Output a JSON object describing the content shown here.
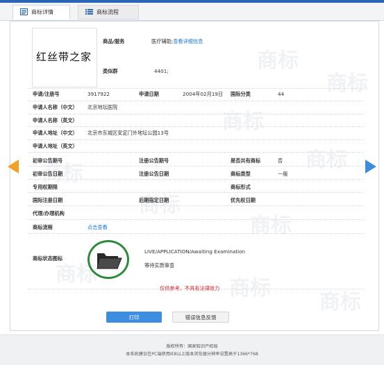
{
  "tabs": {
    "detail": "商标详情",
    "process": "商标流程"
  },
  "logo": {
    "text": "红丝带之家"
  },
  "header": {
    "goods_label": "商品/服务",
    "goods_value": "医疗辅助;",
    "goods_link": "查看详细信息",
    "class_label": "类似群",
    "class_value": "4401;"
  },
  "fields": {
    "reg_no_label": "申请/注册号",
    "reg_no_value": "3917922",
    "apply_date_label": "申请日期",
    "apply_date_value": "2004年02月19日",
    "intl_class_label": "国际分类",
    "intl_class_value": "44",
    "applicant_cn_label": "申请人名称（中文）",
    "applicant_cn_value": "北京地坛医院",
    "applicant_en_label": "申请人名称（英文）",
    "address_cn_label": "申请人地址（中文）",
    "address_cn_value": "北京市东城区安定门外地坛公园13号",
    "address_en_label": "申请人地址（英文）",
    "prelim_no_label": "初审公告期号",
    "reg_pub_no_label": "注册公告期号",
    "shared_label": "是否共有商标",
    "shared_value": "否",
    "prelim_date_label": "初审公告日期",
    "reg_pub_date_label": "注册公告日期",
    "tm_type_label": "商标类型",
    "tm_type_value": "一般",
    "exclusive_label": "专用权期限",
    "tm_form_label": "商标形式",
    "intl_reg_date_label": "国际注册日期",
    "later_date_label": "后期指定日期",
    "priority_date_label": "优先权日期",
    "agent_label": "代理/办理机构",
    "process_label": "商标流程",
    "process_link": "点击查看",
    "status_label": "商标状态图标",
    "status_en": "LIVE/APPLICATION/Awaiting Examination",
    "status_cn": "等待实质审查"
  },
  "notice": "仅供参考，不具有法律效力",
  "buttons": {
    "print": "打印",
    "feedback": "错误信息反馈"
  },
  "footer": {
    "line1": "版权所有：国家知识产权局",
    "line2": "本系统建议在PC端使用IE8以上版本浏览器分辨率设置高于1366*768"
  },
  "watermark": {
    "text": "商标"
  },
  "colors": {
    "accent_blue": "#1d74d3",
    "notice_red": "#d9262b",
    "status_ring": "#2d8a3a",
    "arrow_left": "#f3a024",
    "arrow_right": "#3f8dd8"
  }
}
